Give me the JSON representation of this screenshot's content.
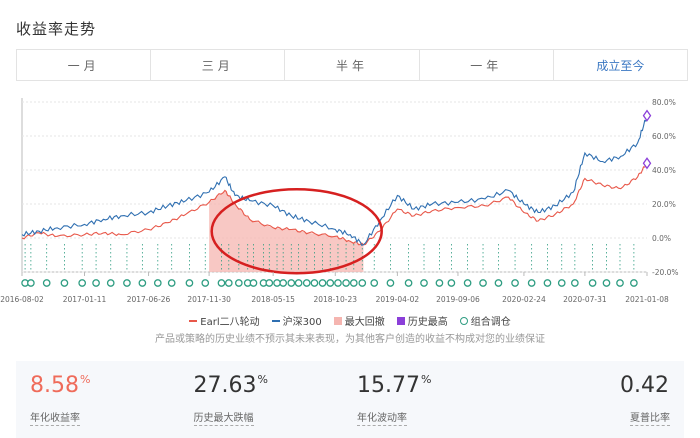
{
  "section": {
    "title": "收益率走势"
  },
  "tabs": [
    {
      "label": "一月",
      "active": false
    },
    {
      "label": "三月",
      "active": false
    },
    {
      "label": "半年",
      "active": false
    },
    {
      "label": "一年",
      "active": false
    },
    {
      "label": "成立至今",
      "active": true
    }
  ],
  "chart_data": {
    "type": "line",
    "x_ticks": [
      "2016-08-02",
      "2017-01-11",
      "2017-06-26",
      "2017-11-30",
      "2018-05-15",
      "2018-10-23",
      "2019-04-02",
      "2019-09-06",
      "2020-02-24",
      "2020-07-31",
      "2021-01-08"
    ],
    "y_ticks": [
      "80.0%",
      "60.0%",
      "40.0%",
      "20.0%",
      "0.0%",
      "-20.0%"
    ],
    "ylim": [
      -20,
      80
    ],
    "series": [
      {
        "name": "Earl二八轮动",
        "color": "#e8584a",
        "points": [
          [
            "2016-08-02",
            0
          ],
          [
            "2016-09-15",
            3
          ],
          [
            "2016-11-01",
            1
          ],
          [
            "2017-01-11",
            2
          ],
          [
            "2017-03-01",
            3
          ],
          [
            "2017-04-15",
            2
          ],
          [
            "2017-06-26",
            5
          ],
          [
            "2017-08-15",
            9
          ],
          [
            "2017-10-01",
            14
          ],
          [
            "2017-11-30",
            21
          ],
          [
            "2018-01-10",
            28
          ],
          [
            "2018-02-05",
            20
          ],
          [
            "2018-03-15",
            11
          ],
          [
            "2018-05-15",
            6
          ],
          [
            "2018-07-01",
            5
          ],
          [
            "2018-08-15",
            3
          ],
          [
            "2018-10-23",
            1
          ],
          [
            "2018-12-01",
            -2
          ],
          [
            "2019-01-04",
            -4
          ],
          [
            "2019-02-15",
            4
          ],
          [
            "2019-04-02",
            17
          ],
          [
            "2019-05-15",
            13
          ],
          [
            "2019-07-01",
            16
          ],
          [
            "2019-09-06",
            18
          ],
          [
            "2019-11-15",
            19
          ],
          [
            "2020-01-15",
            24
          ],
          [
            "2020-02-24",
            15
          ],
          [
            "2020-04-01",
            10
          ],
          [
            "2020-05-15",
            14
          ],
          [
            "2020-07-01",
            20
          ],
          [
            "2020-07-31",
            35
          ],
          [
            "2020-09-15",
            31
          ],
          [
            "2020-11-01",
            29
          ],
          [
            "2020-12-15",
            36
          ],
          [
            "2021-01-08",
            44
          ]
        ]
      },
      {
        "name": "沪深300",
        "color": "#2f6fb1",
        "points": [
          [
            "2016-08-02",
            2
          ],
          [
            "2016-09-15",
            4
          ],
          [
            "2016-11-01",
            6
          ],
          [
            "2017-01-11",
            8
          ],
          [
            "2017-03-01",
            11
          ],
          [
            "2017-04-15",
            13
          ],
          [
            "2017-06-26",
            15
          ],
          [
            "2017-08-15",
            19
          ],
          [
            "2017-10-01",
            22
          ],
          [
            "2017-11-30",
            27
          ],
          [
            "2018-01-10",
            36
          ],
          [
            "2018-02-05",
            25
          ],
          [
            "2018-03-15",
            22
          ],
          [
            "2018-05-15",
            19
          ],
          [
            "2018-07-01",
            13
          ],
          [
            "2018-08-15",
            10
          ],
          [
            "2018-10-23",
            5
          ],
          [
            "2018-12-01",
            2
          ],
          [
            "2019-01-04",
            -4
          ],
          [
            "2019-02-15",
            10
          ],
          [
            "2019-04-02",
            25
          ],
          [
            "2019-05-15",
            17
          ],
          [
            "2019-07-01",
            20
          ],
          [
            "2019-09-06",
            21
          ],
          [
            "2019-11-15",
            23
          ],
          [
            "2020-01-15",
            28
          ],
          [
            "2020-02-24",
            20
          ],
          [
            "2020-04-01",
            15
          ],
          [
            "2020-05-15",
            19
          ],
          [
            "2020-07-01",
            27
          ],
          [
            "2020-07-31",
            50
          ],
          [
            "2020-09-15",
            45
          ],
          [
            "2020-11-01",
            48
          ],
          [
            "2020-12-15",
            56
          ],
          [
            "2021-01-08",
            72
          ]
        ]
      }
    ],
    "max_drawdown": {
      "start": "2017-11-30",
      "end": "2019-01-04",
      "color": "#f5b5b0"
    },
    "history_high": {
      "color": "#8b3fd9"
    },
    "rebalance": {
      "color": "#2f9d82",
      "dates": [
        "2016-08-10",
        "2016-08-25",
        "2016-10-05",
        "2016-11-20",
        "2017-01-05",
        "2017-02-10",
        "2017-03-20",
        "2017-05-01",
        "2017-06-10",
        "2017-07-20",
        "2017-08-25",
        "2017-10-10",
        "2017-11-20",
        "2018-01-01",
        "2018-01-20",
        "2018-02-15",
        "2018-03-10",
        "2018-03-25",
        "2018-04-20",
        "2018-05-05",
        "2018-05-25",
        "2018-06-10",
        "2018-07-01",
        "2018-07-20",
        "2018-08-10",
        "2018-08-30",
        "2018-09-20",
        "2018-10-10",
        "2018-10-30",
        "2018-11-20",
        "2018-12-10",
        "2019-01-01",
        "2019-02-01",
        "2019-03-15",
        "2019-05-01",
        "2019-06-10",
        "2019-07-20",
        "2019-08-20",
        "2019-10-01",
        "2019-11-10",
        "2019-12-20",
        "2020-02-01",
        "2020-03-15",
        "2020-04-25",
        "2020-06-01",
        "2020-07-05",
        "2020-08-20",
        "2020-09-25",
        "2020-10-30",
        "2020-12-05"
      ]
    }
  },
  "legend": [
    {
      "label": "Earl二八轮动",
      "type": "line",
      "color": "#e8584a"
    },
    {
      "label": "沪深300",
      "type": "line",
      "color": "#2f6fb1"
    },
    {
      "label": "最大回撤",
      "type": "box",
      "color": "#f5b5b0"
    },
    {
      "label": "历史最高",
      "type": "box",
      "color": "#8b3fd9"
    },
    {
      "label": "组合调仓",
      "type": "circle",
      "color": "#2f9d82"
    }
  ],
  "disclaimer": "产品或策略的历史业绩不预示其未来表现，为其他客户创造的收益不构成对您的业绩保证",
  "stats": [
    {
      "value": "8.58",
      "unit": "%",
      "label": "年化收益率",
      "highlight": true
    },
    {
      "value": "27.63",
      "unit": "%",
      "label": "历史最大跌幅",
      "highlight": false
    },
    {
      "value": "15.77",
      "unit": "%",
      "label": "年化波动率",
      "highlight": false
    },
    {
      "value": "0.42",
      "unit": "",
      "label": "夏普比率",
      "highlight": false
    }
  ],
  "annotation_color": "#d62020"
}
